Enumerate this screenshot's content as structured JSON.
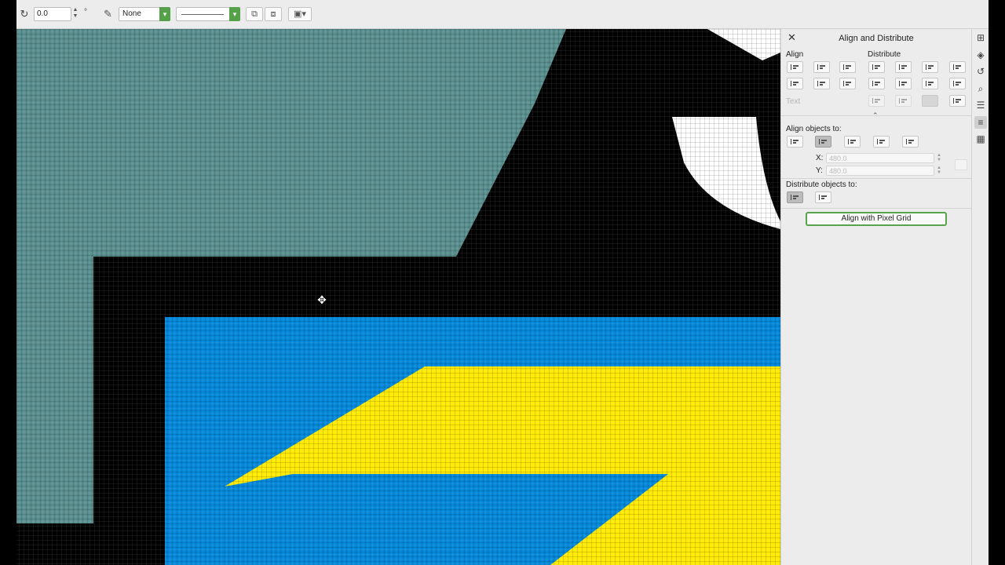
{
  "propbar": {
    "rotation_value": "0.0",
    "degree_symbol": "°",
    "outline_style": "None",
    "icons": [
      "rotate-icon",
      "pen-icon",
      "wrap-text-icon",
      "order-icon",
      "frame-dropdown-icon"
    ],
    "accent": "#56a04a"
  },
  "canvas": {
    "colors": {
      "teal": "#5a8f8f",
      "black": "#000000",
      "blue": "#0088db",
      "yellow": "#ffea00",
      "white": "#ffffff"
    }
  },
  "docker": {
    "title": "Align and Distribute",
    "align_label": "Align",
    "distribute_label": "Distribute",
    "text_label": "Text",
    "align_objects_to": "Align objects to:",
    "x_label": "X:",
    "y_label": "Y:",
    "x_value": "480.0",
    "y_value": "480.0",
    "distribute_objects_to": "Distribute objects to:",
    "pixel_grid_button": "Align with Pixel Grid"
  },
  "right_toolbar": {
    "icons": [
      "properties-icon",
      "layers-icon",
      "history-icon",
      "find-icon",
      "objects-icon",
      "align-icon",
      "table-icon"
    ]
  }
}
